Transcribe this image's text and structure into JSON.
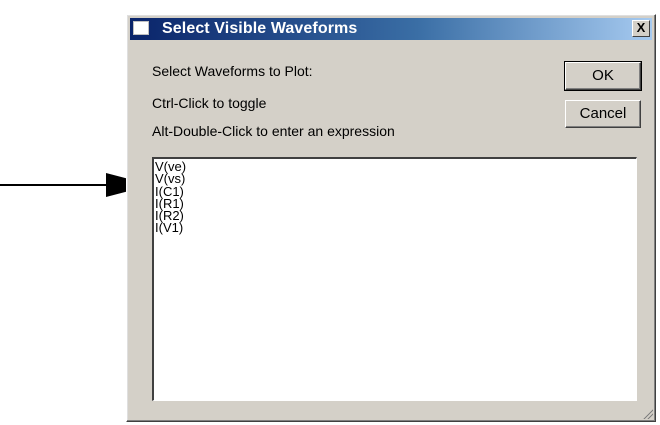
{
  "dialog": {
    "title": "Select Visible Waveforms",
    "close_label": "X",
    "instructions": [
      "Select Waveforms to Plot:",
      "Ctrl-Click to toggle",
      "Alt-Double-Click to enter an expression"
    ],
    "buttons": {
      "ok_label": "OK",
      "cancel_label": "Cancel"
    },
    "waveforms": [
      "V(ve)",
      "V(vs)",
      "I(C1)",
      "I(R1)",
      "I(R2)",
      "I(V1)"
    ]
  },
  "icons": {
    "pointer_arrow": "arrow-right-icon",
    "app_icon": "window-icon",
    "close": "close-icon",
    "resize_grip": "resize-grip-icon"
  },
  "colors": {
    "titlebar_start": "#0a246a",
    "titlebar_end": "#a6caf0",
    "dialog_face": "#d4d0c8"
  }
}
